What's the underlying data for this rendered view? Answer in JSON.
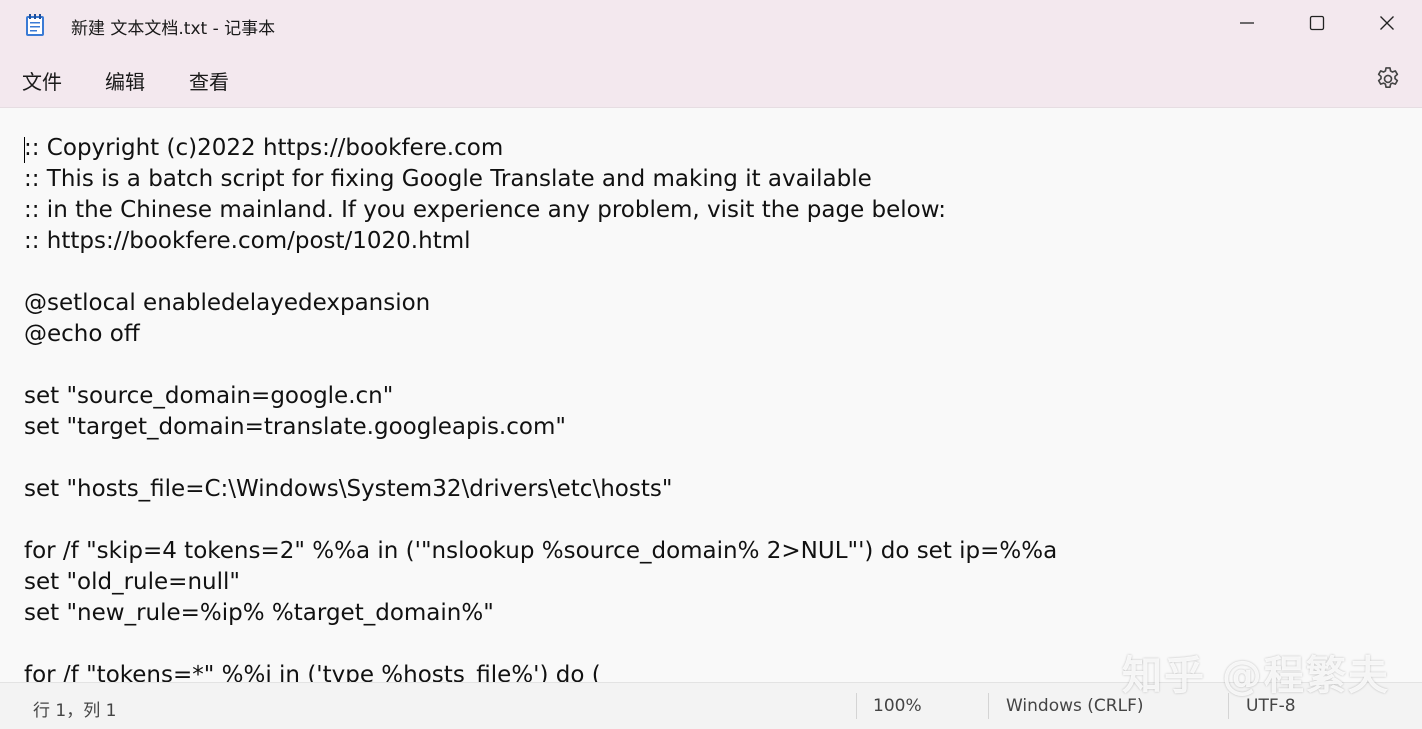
{
  "window": {
    "title": "新建 文本文档.txt - 记事本",
    "app_icon": "notepad-icon",
    "controls": [
      "minimize-icon",
      "maximize-icon",
      "close-icon"
    ]
  },
  "menu": {
    "items": [
      {
        "label": "文件"
      },
      {
        "label": "编辑"
      },
      {
        "label": "查看"
      }
    ],
    "settings_icon": "gear-icon"
  },
  "editor": {
    "content": ":: Copyright (c)2022 https://bookfere.com\n:: This is a batch script for fixing Google Translate and making it available\n:: in the Chinese mainland. If you experience any problem, visit the page below:\n:: https://bookfere.com/post/1020.html\n\n@setlocal enabledelayedexpansion\n@echo off\n\nset \"source_domain=google.cn\"\nset \"target_domain=translate.googleapis.com\"\n\nset \"hosts_file=C:\\Windows\\System32\\drivers\\etc\\hosts\"\n\nfor /f \"skip=4 tokens=2\" %%a in ('\"nslookup %source_domain% 2>NUL\"') do set ip=%%a\nset \"old_rule=null\"\nset \"new_rule=%ip% %target_domain%\"\n\nfor /f \"tokens=*\" %%i in ('type %hosts_file%') do ("
  },
  "status": {
    "position": "行 1，列 1",
    "zoom": "100%",
    "line_ending": "Windows (CRLF)",
    "encoding": "UTF-8"
  },
  "watermark": "知乎 @程繁夫",
  "colors": {
    "titlebar_bg": "#f3e8ee",
    "editor_bg": "#f9f9f9",
    "statusbar_bg": "#f3f3f3"
  }
}
